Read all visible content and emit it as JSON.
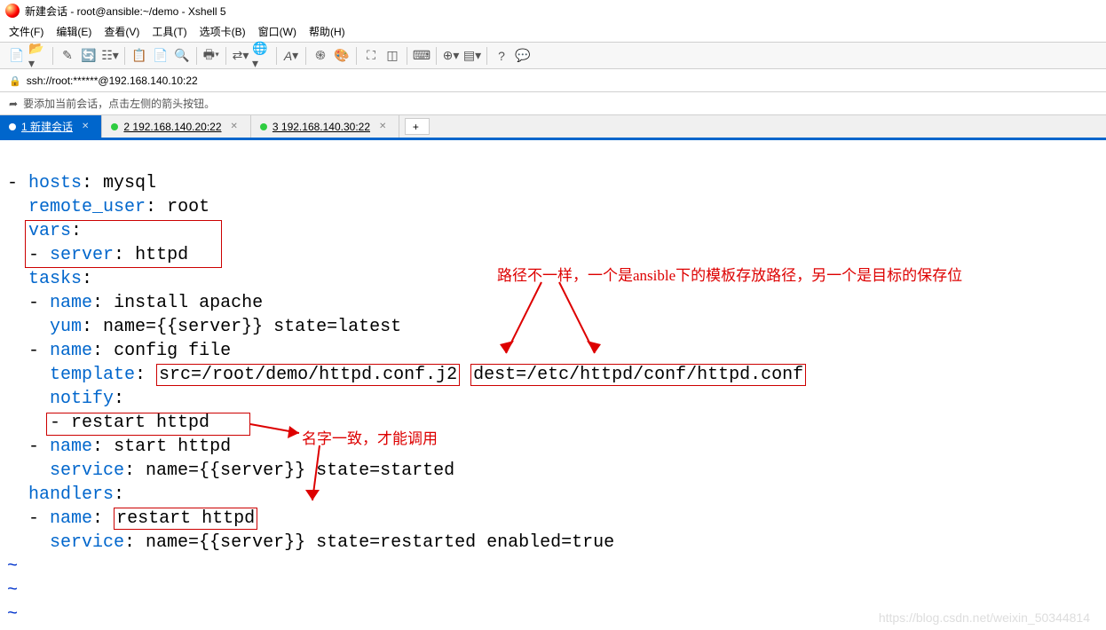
{
  "title": "新建会话 - root@ansible:~/demo - Xshell 5",
  "menu": {
    "file": "文件(F)",
    "edit": "编辑(E)",
    "view": "查看(V)",
    "tools": "工具(T)",
    "tabs": "选项卡(B)",
    "window": "窗口(W)",
    "help": "帮助(H)"
  },
  "address": "ssh://root:******@192.168.140.10:22",
  "session_note": "要添加当前会话，点击左侧的箭头按钮。",
  "tabs": [
    {
      "label": "1 新建会话",
      "active": true
    },
    {
      "label": "2 192.168.140.20:22",
      "active": false
    },
    {
      "label": "3 192.168.140.30:22",
      "active": false
    }
  ],
  "yaml": {
    "hosts": "hosts",
    "hosts_val": "mysql",
    "remote_user": "remote_user",
    "remote_user_val": "root",
    "vars": "vars",
    "server": "server",
    "server_val": "httpd",
    "tasks": "tasks",
    "name": "name",
    "install": "install apache",
    "yum": "yum",
    "yum_val": "name={{server}} state=latest",
    "config": "config file",
    "template": "template",
    "src": "src=/root/demo/httpd.conf.j2",
    "dest": "dest=/etc/httpd/conf/httpd.conf",
    "notify": "notify",
    "restart": "restart httpd",
    "start": "start httpd",
    "service": "service",
    "svc_started": "name={{server}} state=started",
    "handlers": "handlers",
    "svc_restarted": "name={{server}} state=restarted enabled=true"
  },
  "annotations": {
    "path_note": "路径不一样，一个是ansible下的模板存放路径，另一个是目标的保存位",
    "name_note": "名字一致，才能调用"
  },
  "watermark": "https://blog.csdn.net/weixin_50344814"
}
